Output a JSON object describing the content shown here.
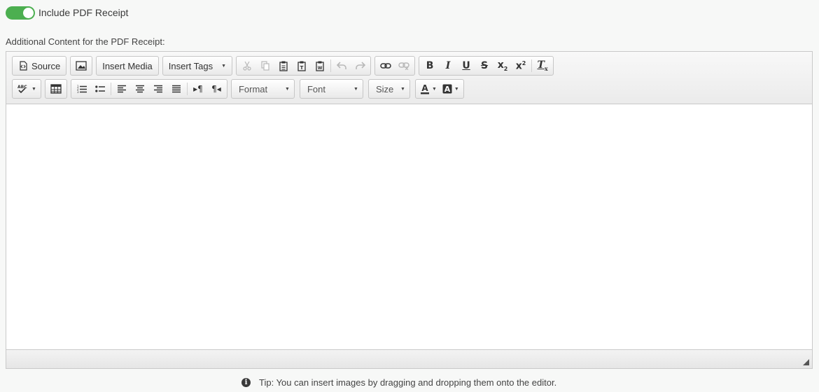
{
  "toggle": {
    "label": "Include PDF Receipt",
    "on": true,
    "color": "#4caf50"
  },
  "section_label": "Additional Content for the PDF Receipt:",
  "toolbar": {
    "source": "Source",
    "insert_media": "Insert Media",
    "insert_tags": "Insert Tags",
    "format": "Format",
    "font": "Font",
    "size": "Size"
  },
  "tip": {
    "text": "Tip: You can insert images by dragging and dropping them onto the editor."
  }
}
